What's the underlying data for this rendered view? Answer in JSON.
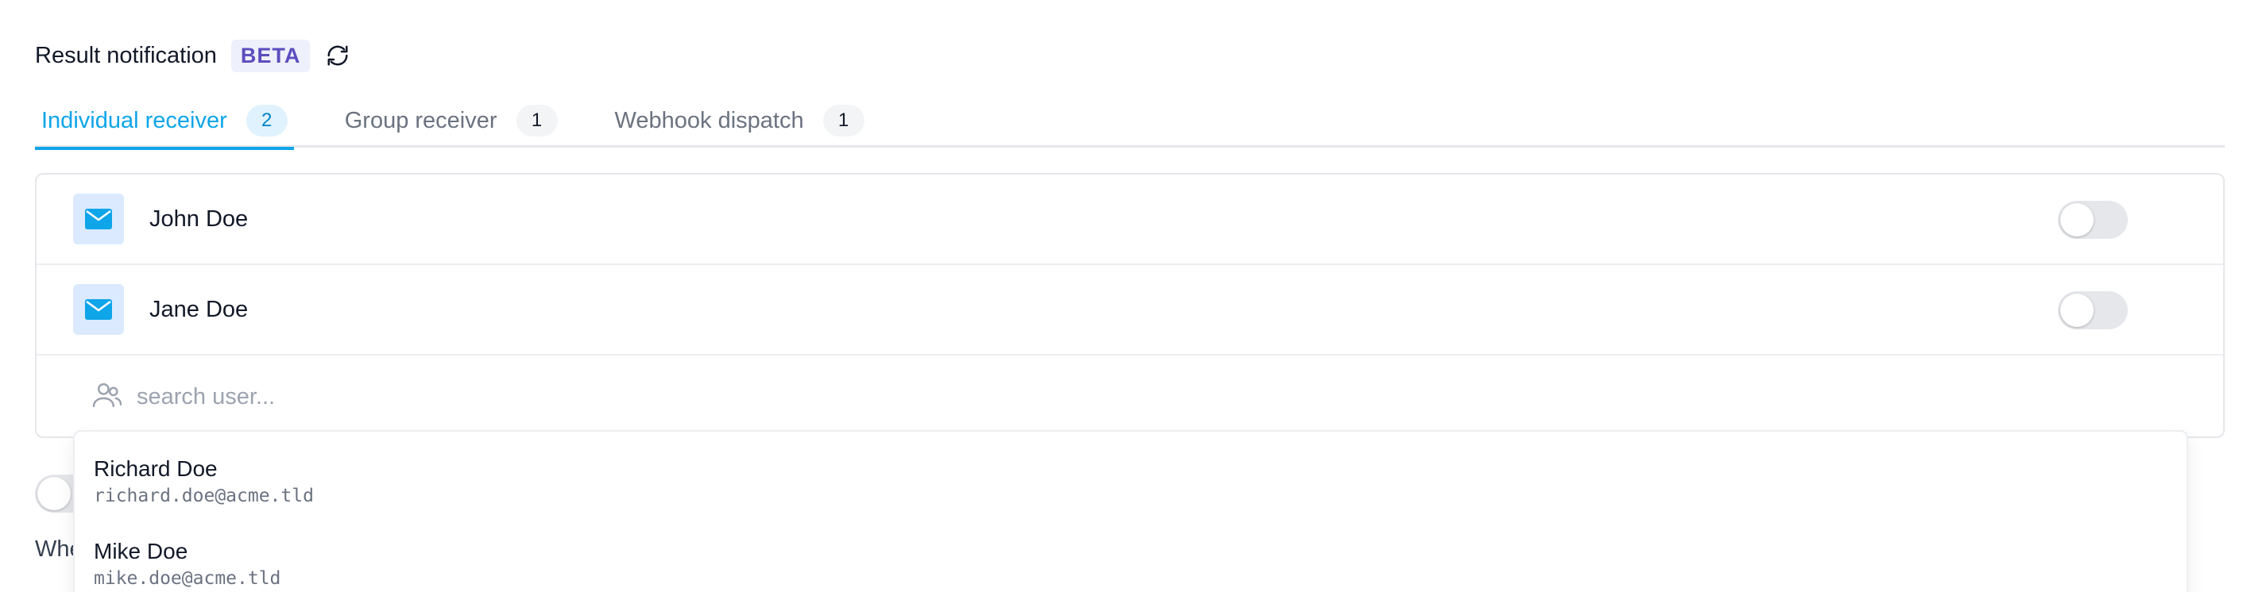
{
  "header": {
    "title": "Result notification",
    "badge": "BETA",
    "refresh_icon": "refresh-icon"
  },
  "tabs": [
    {
      "label": "Individual receiver",
      "count": "2",
      "active": true
    },
    {
      "label": "Group receiver",
      "count": "1",
      "active": false
    },
    {
      "label": "Webhook dispatch",
      "count": "1",
      "active": false
    }
  ],
  "receivers": [
    {
      "name": "John Doe",
      "icon": "mail-icon",
      "enabled": false
    },
    {
      "name": "Jane Doe",
      "icon": "mail-icon",
      "enabled": false
    }
  ],
  "search": {
    "placeholder": "search user...",
    "value": "",
    "icon": "users-icon"
  },
  "background": {
    "text_fragment": "Whe"
  },
  "dropdown": {
    "options": [
      {
        "name": "Richard Doe",
        "email": "richard.doe@acme.tld"
      },
      {
        "name": "Mike Doe",
        "email": "mike.doe@acme.tld"
      }
    ]
  },
  "colors": {
    "accent": "#0ea5e9",
    "badge_text": "#5b4dbf",
    "badge_bg": "#eef0fb",
    "icon_bg": "#dbeafe",
    "toggle_off": "#e5e7eb"
  }
}
